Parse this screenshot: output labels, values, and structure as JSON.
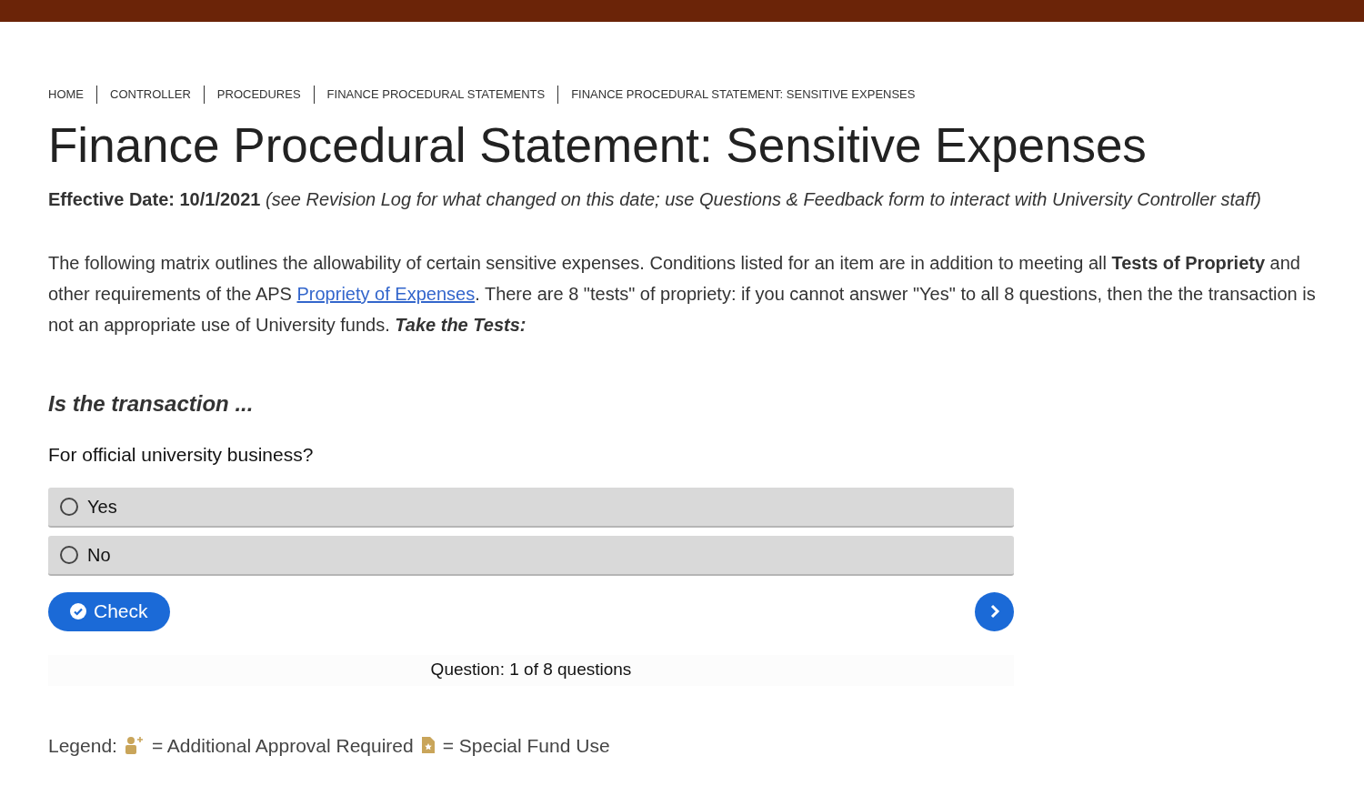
{
  "breadcrumbs": [
    {
      "label": "HOME"
    },
    {
      "label": "CONTROLLER"
    },
    {
      "label": "PROCEDURES"
    },
    {
      "label": "FINANCE PROCEDURAL STATEMENTS"
    },
    {
      "label": "FINANCE PROCEDURAL STATEMENT: SENSITIVE EXPENSES"
    }
  ],
  "title": "Finance Procedural Statement: Sensitive Expenses",
  "effective_line": "**Effective Date: 10/1/2021** *(see Revision Log for what changed on this date; use Questions & Feedback form to interact with University Controller staff)*",
  "intro": {
    "before": "The following matrix outlines the allowability of certain sensitive expenses. Conditions listed for an item are in addition to meeting all **Tests of Propriety** and other requirements of the APS ",
    "link": "Propriety of Expenses",
    "after": ". There are 8 \"tests\" of propriety: if you cannot answer \"Yes\" to all 8 questions, then the the transaction is not an appropriate use of University funds. ",
    "emphasis": "Take the Tests:"
  },
  "quiz": {
    "heading": "Is the transaction ...",
    "question": "For official university business?",
    "options": [
      {
        "label": "Yes",
        "selected": false
      },
      {
        "label": "No",
        "selected": false
      }
    ],
    "check_button": "Check",
    "progress": "Question: 1 of 8 questions"
  },
  "legend": {
    "label": "Legend:",
    "items": [
      {
        "kind": "approval",
        "text": "= Additional Approval Required"
      },
      {
        "kind": "fund",
        "text": "= Special Fund Use"
      }
    ]
  }
}
